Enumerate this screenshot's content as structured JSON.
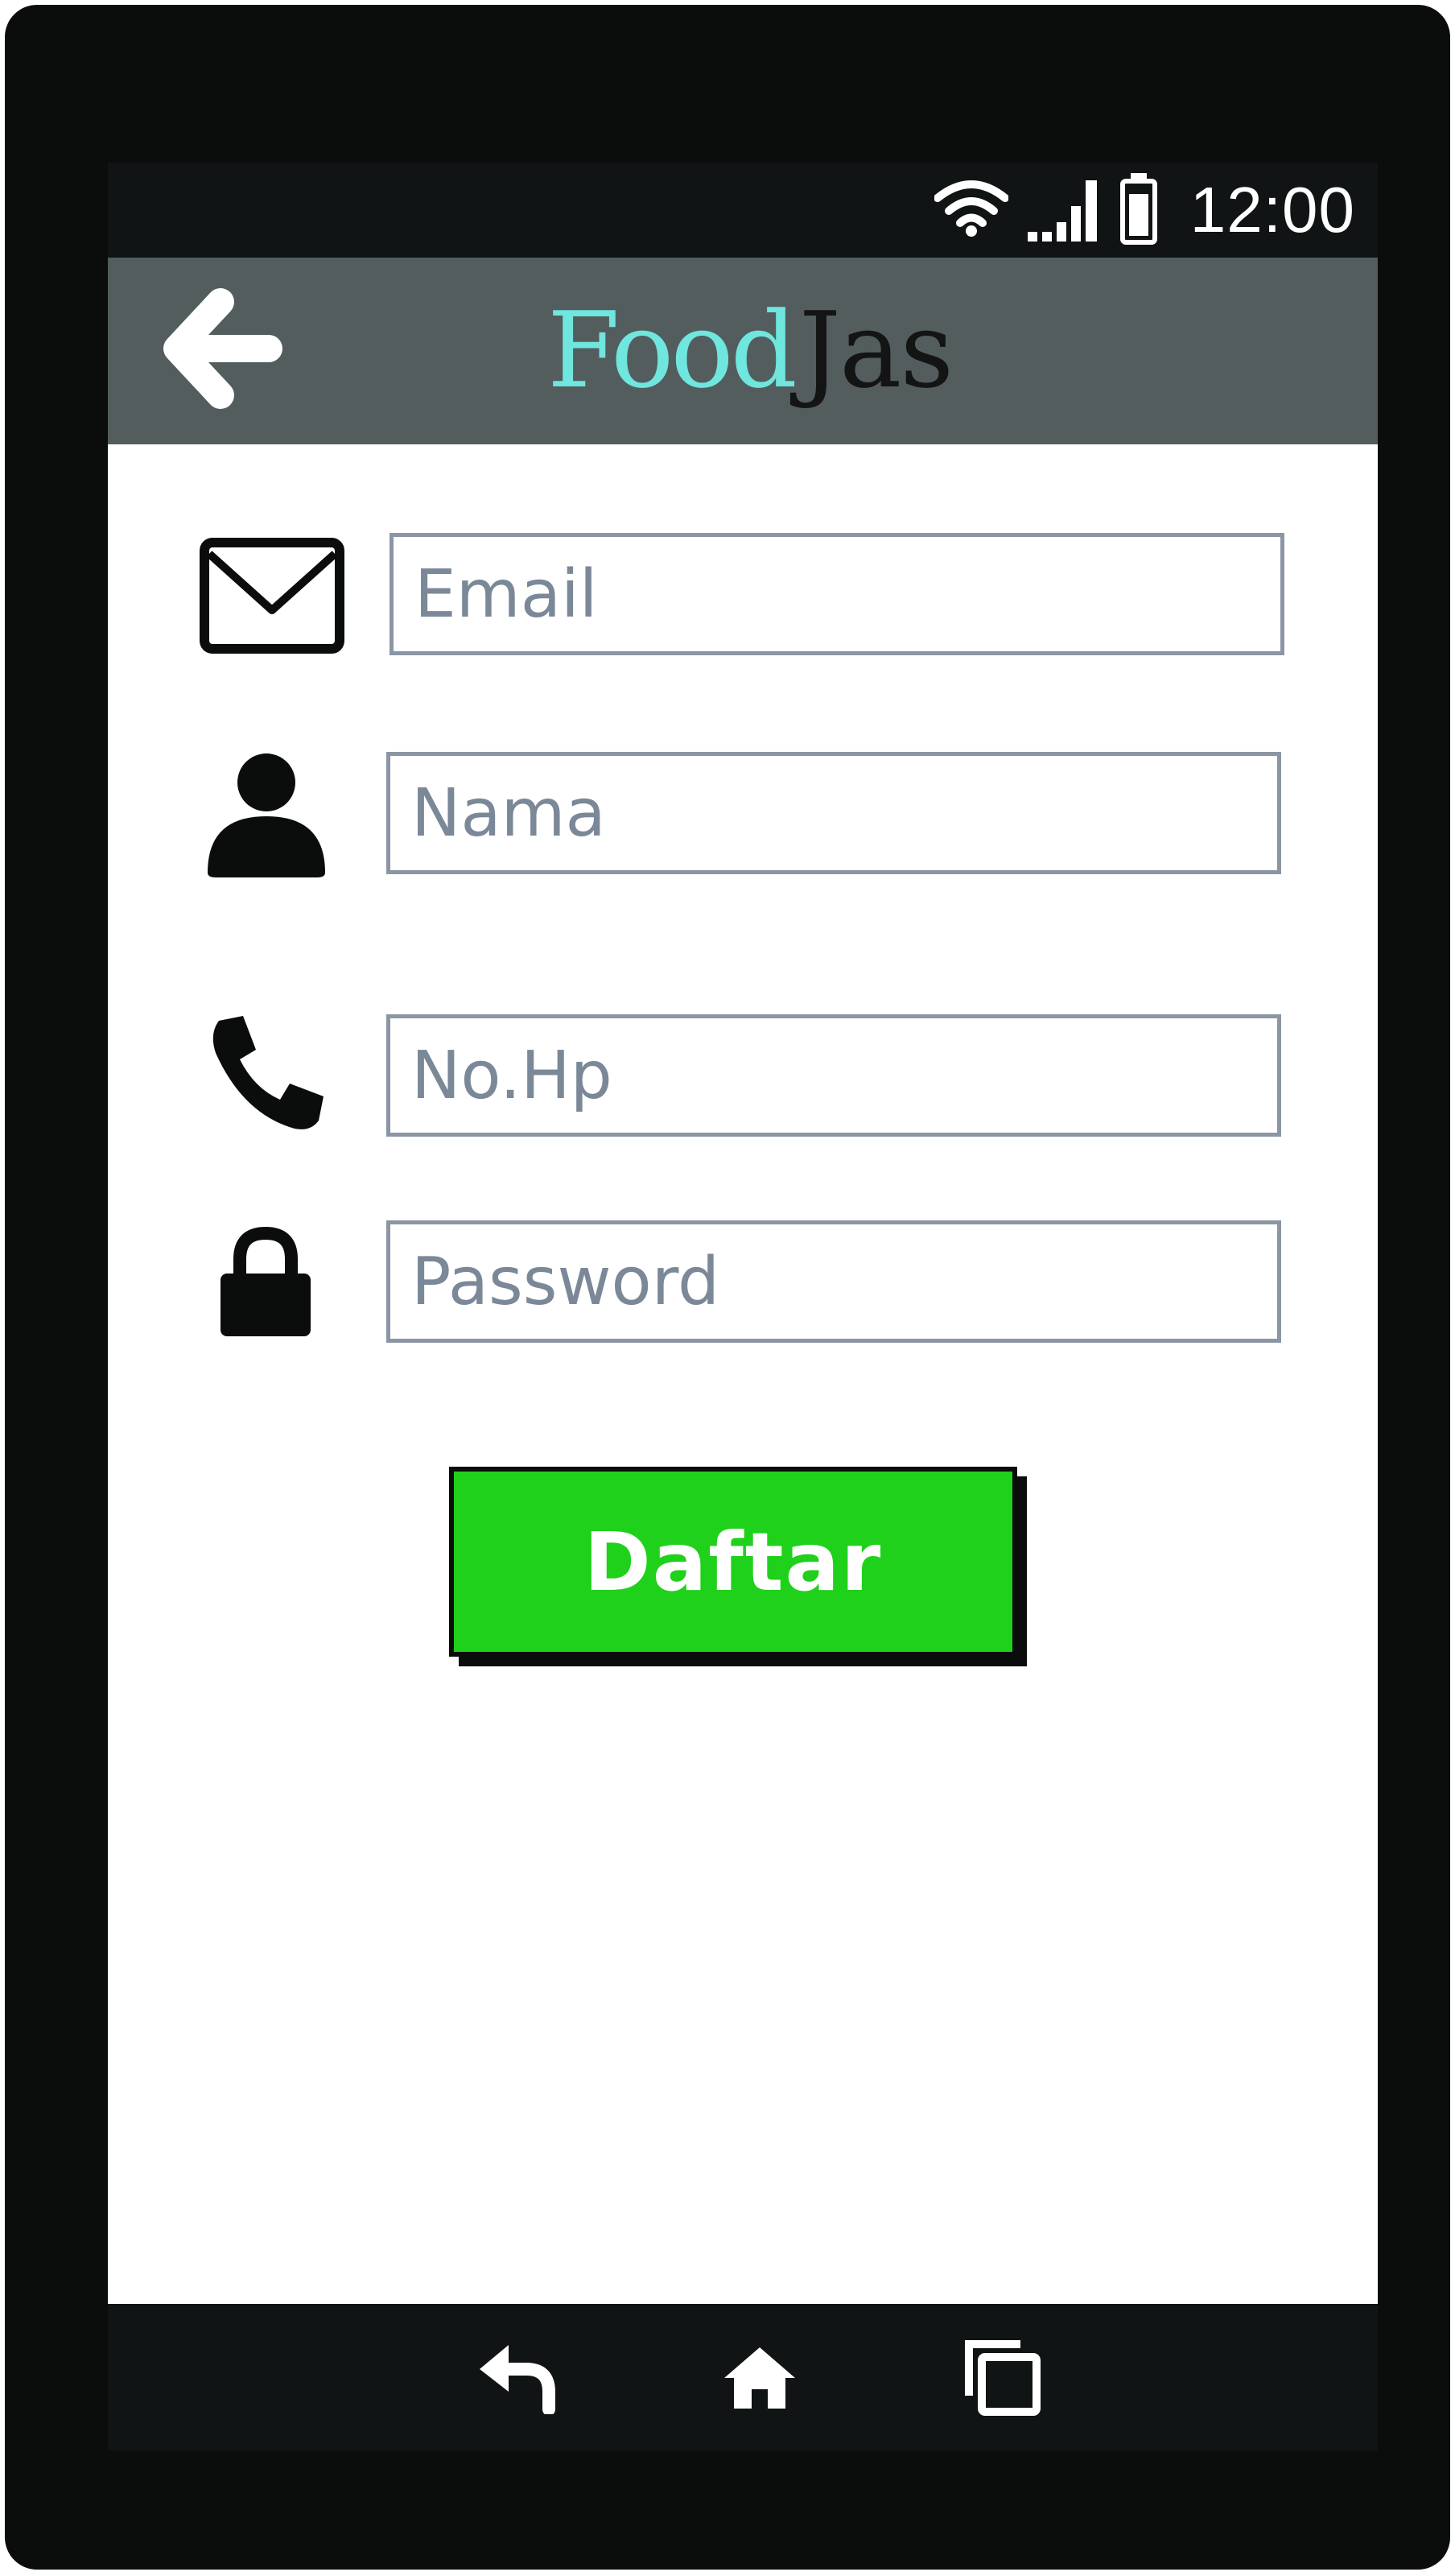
{
  "status_bar": {
    "time": "12:00",
    "icons": [
      "wifi-icon",
      "signal-icon",
      "battery-icon"
    ]
  },
  "app_bar": {
    "back_icon": "arrow-left-icon",
    "logo_part_1": "Food",
    "logo_part_2": "Jas"
  },
  "form": {
    "email": {
      "icon": "envelope-icon",
      "placeholder": "Email",
      "value": ""
    },
    "name": {
      "icon": "user-icon",
      "placeholder": "Nama",
      "value": ""
    },
    "phone": {
      "icon": "phone-icon",
      "placeholder": "No.Hp",
      "value": ""
    },
    "password": {
      "icon": "lock-icon",
      "placeholder": "Password",
      "value": ""
    },
    "submit_label": "Daftar"
  },
  "nav_bar": {
    "buttons": [
      "back-nav-icon",
      "home-icon",
      "recent-apps-icon"
    ]
  },
  "colors": {
    "device": "#0b0c0c",
    "status_bar": "#111414",
    "app_bar": "#535d5d",
    "logo_accent": "#6fe6de",
    "field_border": "#8b96a4",
    "placeholder": "#7b8898",
    "button": "#1fd11a"
  }
}
